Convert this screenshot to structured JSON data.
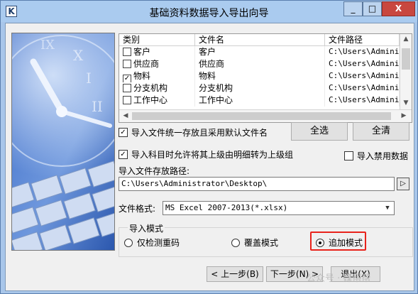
{
  "window": {
    "title": "基础资料数据导入导出向导",
    "icon_letter": "K",
    "controls": {
      "minimize": "_",
      "maximize": "□",
      "close": "X"
    }
  },
  "list": {
    "headers": [
      "类别",
      "文件名",
      "文件路径"
    ],
    "rows": [
      {
        "checked": false,
        "category": "客户",
        "filename": "客户",
        "path": "C:\\Users\\Adminis"
      },
      {
        "checked": false,
        "category": "供应商",
        "filename": "供应商",
        "path": "C:\\Users\\Adminis"
      },
      {
        "checked": true,
        "category": "物料",
        "filename": "物料",
        "path": "C:\\Users\\Adminis"
      },
      {
        "checked": false,
        "category": "分支机构",
        "filename": "分支机构",
        "path": "C:\\Users\\Adminis"
      },
      {
        "checked": false,
        "category": "工作中心",
        "filename": "工作中心",
        "path": "C:\\Users\\Adminis"
      }
    ],
    "check_mark": "✓",
    "scroll_up": "▲",
    "scroll_down": "▼",
    "scroll_left": "◀",
    "scroll_right": "▶"
  },
  "options": {
    "default_filename": {
      "label": "导入文件统一存放且采用默认文件名",
      "checked": true
    },
    "allow_upgrade": {
      "label": "导入科目时允许将其上级由明细转为上级组",
      "checked": true
    },
    "import_disabled": {
      "label": "导入禁用数据",
      "checked": false
    }
  },
  "buttons": {
    "select_all": "全选",
    "clear_all": "全清",
    "prev": "< 上一步(B)",
    "next": "下一步(N) >",
    "exit": "退出(X)"
  },
  "path": {
    "label": "导入文件存放路径:",
    "value": "C:\\Users\\Administrator\\Desktop\\",
    "browse_icon": "▷"
  },
  "format": {
    "label": "文件格式:",
    "selected": "MS Excel 2007-2013(*.xlsx)"
  },
  "import_mode": {
    "title": "导入模式",
    "options": [
      {
        "label": "仅检测重码",
        "selected": false
      },
      {
        "label": "覆盖模式",
        "selected": false
      },
      {
        "label": "追加模式",
        "selected": true
      }
    ]
  },
  "watermark": "公众号 · 媒帮帮"
}
